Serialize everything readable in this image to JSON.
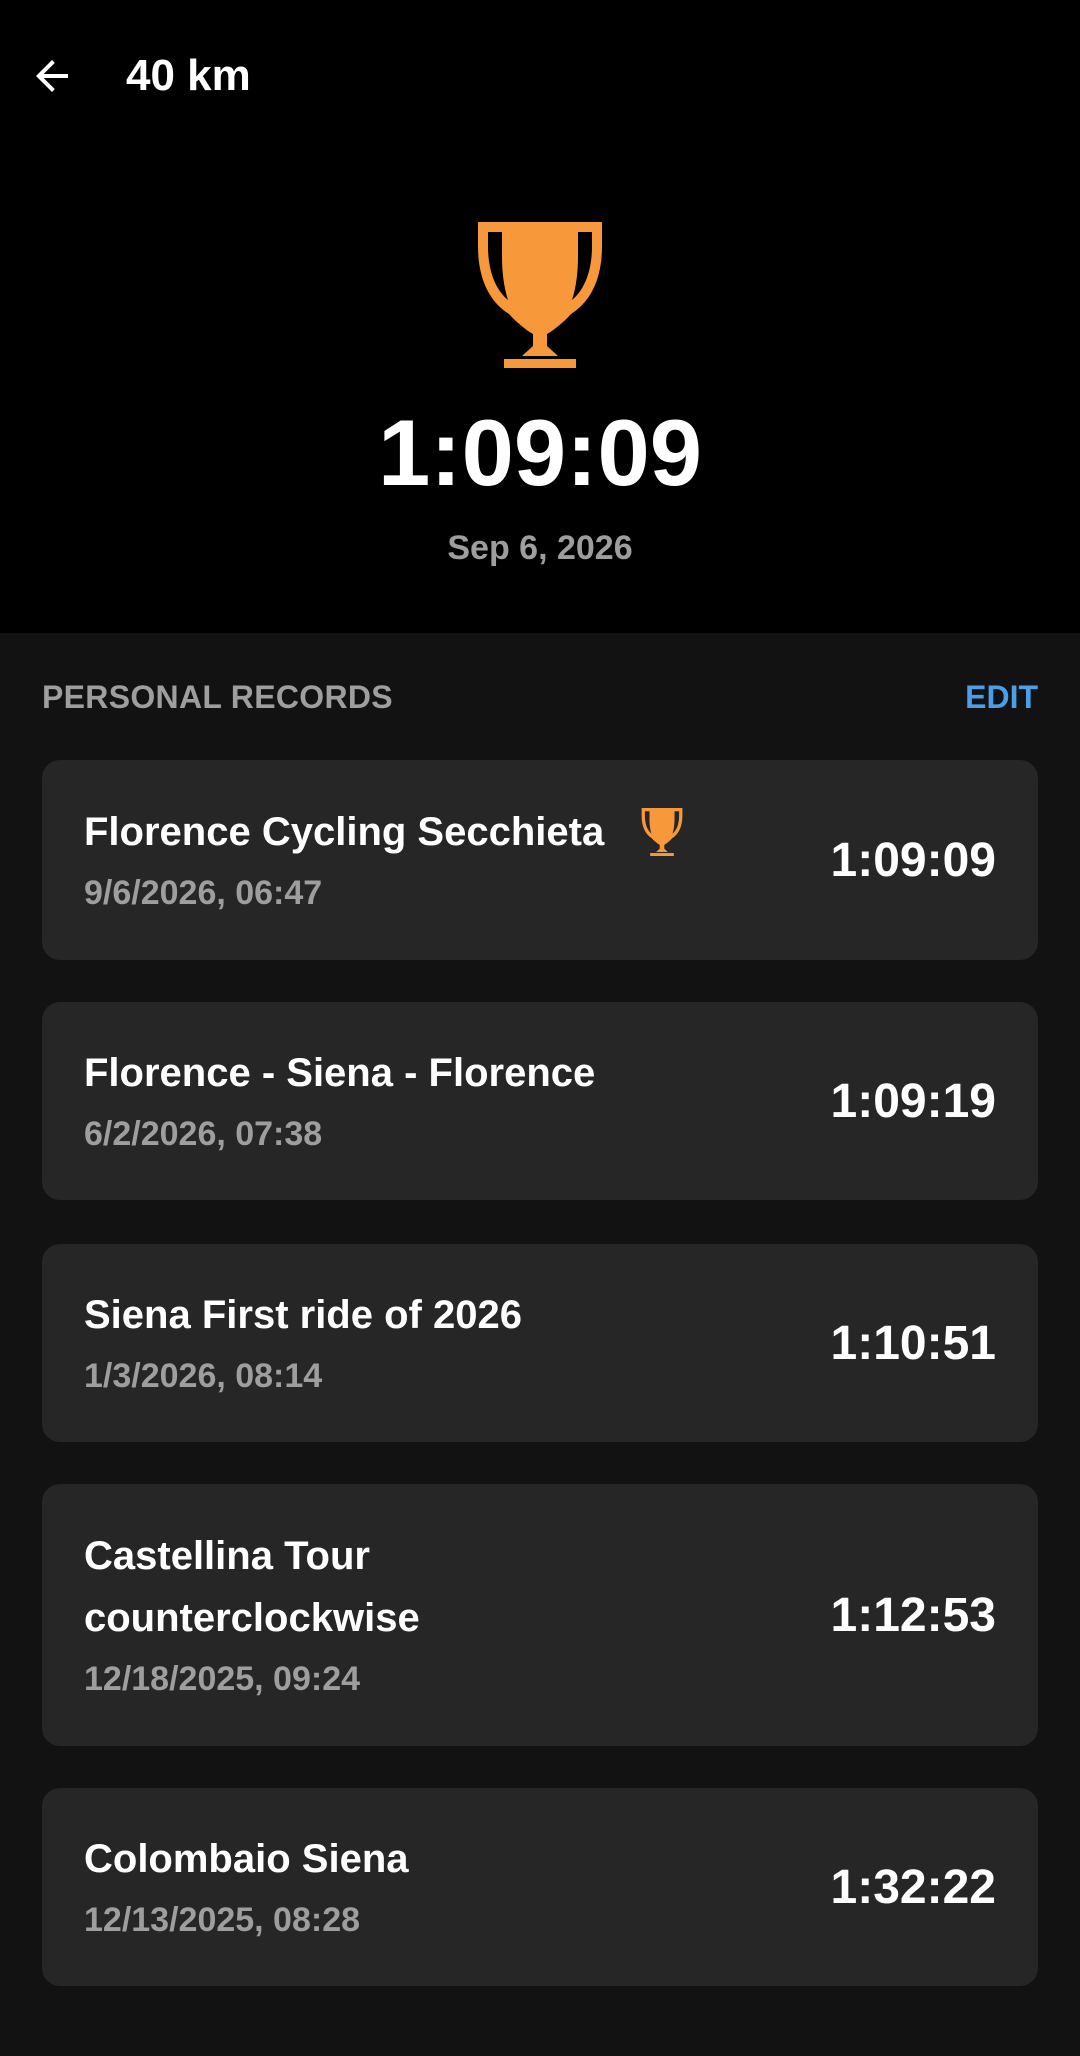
{
  "header": {
    "title": "40 km"
  },
  "hero": {
    "time": "1:09:09",
    "date": "Sep 6, 2026"
  },
  "section": {
    "title": "PERSONAL RECORDS",
    "edit_label": "EDIT"
  },
  "colors": {
    "trophy": "#F7993A",
    "accent": "#4A9FE8",
    "card": "#262626",
    "secondary_text": "#9E9E9E"
  },
  "records": [
    {
      "name": "Florence Cycling Secchieta",
      "date": "9/6/2026, 06:47",
      "time": "1:09:09",
      "best": true
    },
    {
      "name": "Florence - Siena - Florence",
      "date": "6/2/2026, 07:38",
      "time": "1:09:19",
      "best": false
    },
    {
      "name": "Siena First ride of 2026",
      "date": "1/3/2026, 08:14",
      "time": "1:10:51",
      "best": false
    },
    {
      "name": "Castellina Tour counterclockwise",
      "date": "12/18/2025, 09:24",
      "time": "1:12:53",
      "best": false
    },
    {
      "name": "Colombaio Siena",
      "date": "12/13/2025, 08:28",
      "time": "1:32:22",
      "best": false
    }
  ]
}
